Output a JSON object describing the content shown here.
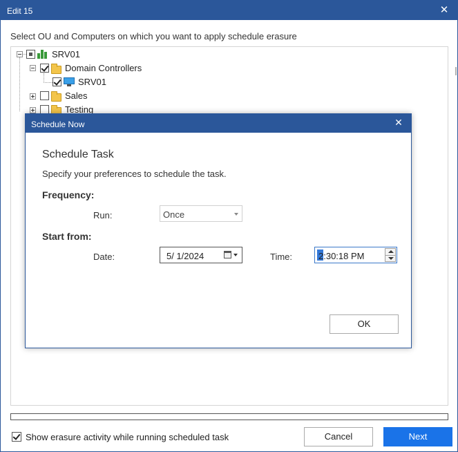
{
  "window": {
    "title": "Edit 15",
    "close_glyph": "✕"
  },
  "instruction": "Select OU and Computers on which you want to apply schedule erasure",
  "tree": {
    "root": {
      "label": "SRV01",
      "icon": "server-group-icon",
      "state": "partial"
    },
    "domain_controllers": {
      "label": "Domain Controllers",
      "icon": "folder-icon",
      "state": "checked"
    },
    "srv01_computer": {
      "label": "SRV01",
      "icon": "computer-icon",
      "state": "checked"
    },
    "sales": {
      "label": "Sales",
      "icon": "folder-icon",
      "state": "unchecked"
    },
    "testing": {
      "label": "Testing",
      "icon": "folder-icon",
      "state": "unchecked"
    }
  },
  "progress": {
    "value": 0
  },
  "footer": {
    "show_activity_label": "Show erasure activity while running scheduled task",
    "show_activity_checked": true,
    "cancel_label": "Cancel",
    "next_label": "Next"
  },
  "modal": {
    "title": "Schedule Now",
    "close_glyph": "✕",
    "heading": "Schedule Task",
    "description": "Specify your preferences to schedule the task.",
    "frequency_label": "Frequency:",
    "run_label": "Run:",
    "run_value": "Once",
    "start_label": "Start from:",
    "date_label": "Date:",
    "date_value": "5/  1/2024",
    "time_label": "Time:",
    "time_value": "2:30:18 PM",
    "ok_label": "OK"
  },
  "colors": {
    "accent": "#2b579a",
    "primary_button": "#1a73e8",
    "folder": "#f3c54b"
  }
}
